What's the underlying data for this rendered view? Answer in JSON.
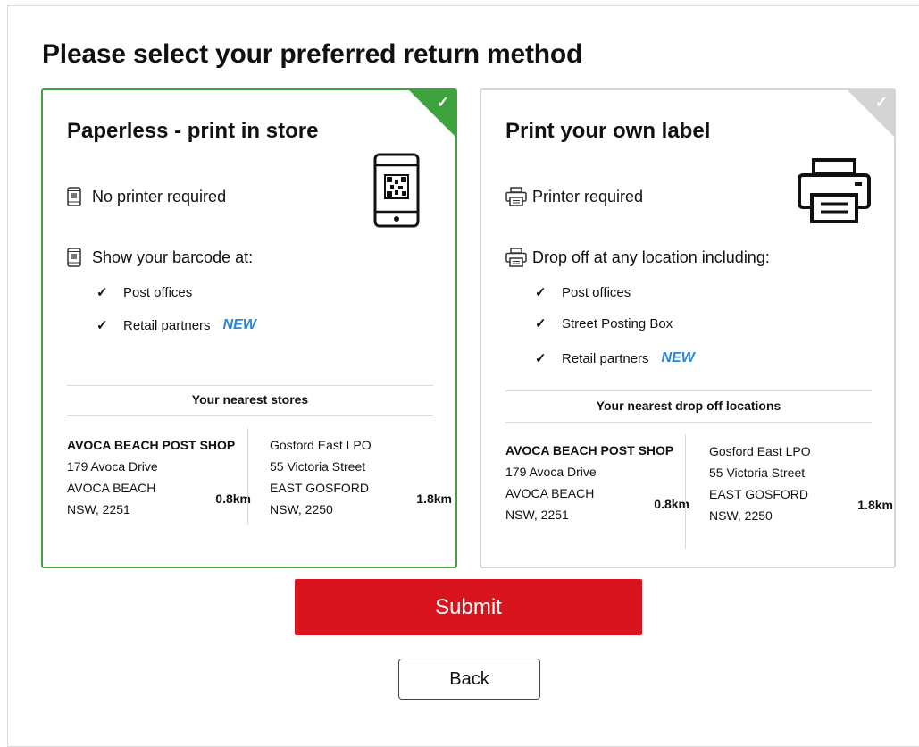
{
  "heading": "Please select your preferred return method",
  "options": [
    {
      "title": "Paperless - print in store",
      "selected": true,
      "features": [
        "No printer required",
        "Show your barcode at:"
      ],
      "checklist": [
        "Post offices",
        "Retail partners"
      ],
      "new_badge": "NEW",
      "nearest_heading": "Your nearest stores",
      "locations": [
        {
          "name": "AVOCA BEACH POST SHOP",
          "street": "179 Avoca Drive",
          "suburb": "AVOCA BEACH",
          "state": "NSW, 2251",
          "distance": "0.8km"
        },
        {
          "name": "Gosford East LPO",
          "street": "55 Victoria Street",
          "suburb": "EAST GOSFORD",
          "state": "NSW, 2250",
          "distance": "1.8km"
        }
      ]
    },
    {
      "title": "Print your own label",
      "selected": false,
      "features": [
        "Printer required",
        "Drop off at any location including:"
      ],
      "checklist": [
        "Post offices",
        "Street Posting Box",
        "Retail partners"
      ],
      "new_badge": "NEW",
      "nearest_heading": "Your nearest drop off locations",
      "locations": [
        {
          "name": "AVOCA BEACH POST SHOP",
          "street": "179 Avoca Drive",
          "suburb": "AVOCA BEACH",
          "state": "NSW, 2251",
          "distance": "0.8km"
        },
        {
          "name": "Gosford East LPO",
          "street": "55 Victoria Street",
          "suburb": "EAST GOSFORD",
          "state": "NSW, 2250",
          "distance": "1.8km"
        }
      ]
    }
  ],
  "buttons": {
    "submit": "Submit",
    "back": "Back"
  },
  "colors": {
    "selected_border": "#3ea33e",
    "unselected_border": "#d6d6d6",
    "submit_bg": "#d9141f",
    "new_badge": "#2d86d8"
  },
  "icons": {
    "paperless_hero": "phone-qr-icon",
    "label_hero": "printer-icon",
    "paperless_feature": "mobile-phone-icon",
    "label_feature": "printer-icon",
    "selected_marker": "checkmark-icon"
  }
}
